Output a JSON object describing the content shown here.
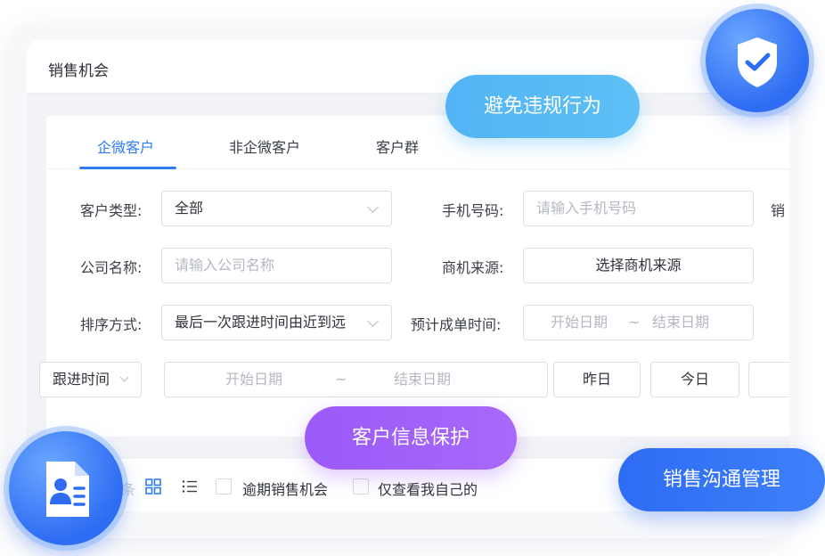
{
  "window": {
    "title": "销售机会"
  },
  "tabs": [
    {
      "label": "企微客户",
      "active": true
    },
    {
      "label": "非企微客户",
      "active": false
    },
    {
      "label": "客户群",
      "active": false
    }
  ],
  "filters": {
    "customer_type_label": "客户类型:",
    "customer_type_value": "全部",
    "phone_label": "手机号码:",
    "phone_placeholder": "请输入手机号码",
    "truncated_label": "销",
    "company_label": "公司名称:",
    "company_placeholder": "请输入公司名称",
    "source_label": "商机来源:",
    "source_button": "选择商机来源",
    "sort_label": "排序方式:",
    "sort_value": "最后一次跟进时间由近到远",
    "deal_time_label": "预计成单时间:",
    "deal_start_placeholder": "开始日期",
    "deal_separator": "~",
    "deal_end_placeholder": "结束日期",
    "followup_select": "跟进时间",
    "followup_start_placeholder": "开始日期",
    "followup_separator": "~",
    "followup_end_placeholder": "结束日期",
    "yesterday_button": "昨日",
    "today_button": "今日"
  },
  "bottom_bar": {
    "truncated_text": "条",
    "overdue_label": "逾期销售机会",
    "mine_label": "仅查看我自己的"
  },
  "callouts": {
    "avoid_violation": "避免违规行为",
    "customer_protect": "客户信息保护",
    "sales_manage": "销售沟通管理"
  },
  "colors": {
    "accent": "#2f7bf6",
    "pill_light": "#55b6f5",
    "pill_purple": "#a060fa",
    "pill_blue": "#3472f6",
    "badge": "#2e6cf3"
  },
  "icons": {
    "shield_badge": "shield-check-icon",
    "doc_badge": "customer-document-icon",
    "grid_view": "grid-view-icon",
    "list_view": "list-view-icon"
  }
}
